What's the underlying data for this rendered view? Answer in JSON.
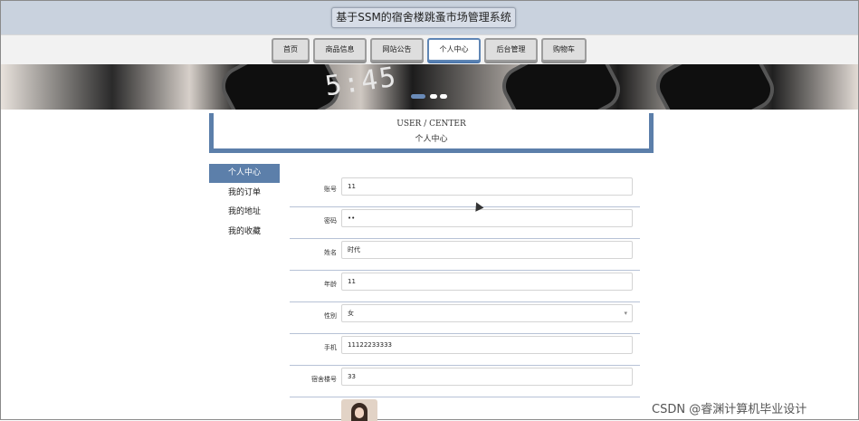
{
  "header": {
    "site_title": "基于SSM的宿舍楼跳蚤市场管理系统"
  },
  "nav": [
    {
      "label": "首页"
    },
    {
      "label": "商品信息"
    },
    {
      "label": "网站公告"
    },
    {
      "label": "个人中心"
    },
    {
      "label": "后台管理"
    },
    {
      "label": "购物车"
    }
  ],
  "banner": {
    "clock_text": "5:45"
  },
  "section": {
    "title_en": "USER / CENTER",
    "title_cn": "个人中心"
  },
  "sidebar": [
    {
      "label": "个人中心"
    },
    {
      "label": "我的订单"
    },
    {
      "label": "我的地址"
    },
    {
      "label": "我的收藏"
    }
  ],
  "form": [
    {
      "label": "账号",
      "value": "11"
    },
    {
      "label": "密码",
      "value": "••"
    },
    {
      "label": "姓名",
      "value": "时代"
    },
    {
      "label": "年龄",
      "value": "11"
    },
    {
      "label": "性别",
      "value": "女"
    },
    {
      "label": "手机",
      "value": "11122233333"
    },
    {
      "label": "宿舍楼号",
      "value": "33"
    }
  ],
  "watermark": "CSDN @睿渊计算机毕业设计",
  "colors": {
    "accent": "#5c7faa",
    "header_bg": "#c9d2de"
  }
}
